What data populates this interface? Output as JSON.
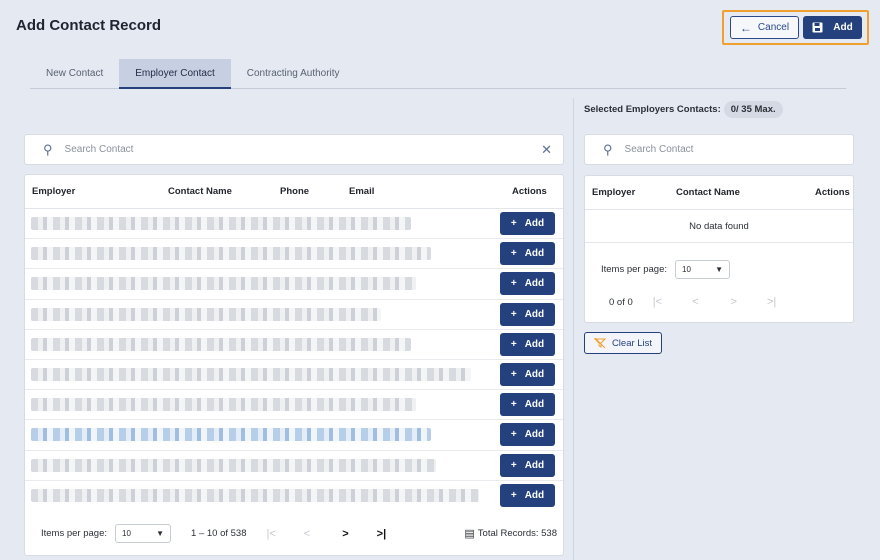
{
  "page": {
    "title": "Add Contact Record"
  },
  "header": {
    "cancel_label": "Cancel",
    "add_label": "Add"
  },
  "tabs": [
    {
      "label": "New Contact"
    },
    {
      "label": "Employer Contact"
    },
    {
      "label": "Contracting Authority"
    }
  ],
  "left": {
    "search_placeholder": "Search Contact",
    "columns": [
      "Employer",
      "Contact Name",
      "Phone",
      "Email",
      "Actions"
    ],
    "row_add_label": "Add",
    "rows_count_visible": 10,
    "footer": {
      "items_per_page_label": "Items per page:",
      "items_per_page": "10",
      "range": "1 – 10 of 538",
      "total_label": "Total Records: 538"
    }
  },
  "right": {
    "selected_label": "Selected Employers Contacts:",
    "selected_badge": "0/ 35 Max.",
    "search_placeholder": "Search Contact",
    "columns": [
      "Employer",
      "Contact Name",
      "Actions"
    ],
    "empty_text": "No data found",
    "items_per_page_label": "Items per page:",
    "items_per_page": "10",
    "range": "0 of 0",
    "clear_label": "Clear List"
  },
  "colors": {
    "primary": "#24417e",
    "highlight": "#f0a030",
    "background": "#e4e9f2"
  }
}
